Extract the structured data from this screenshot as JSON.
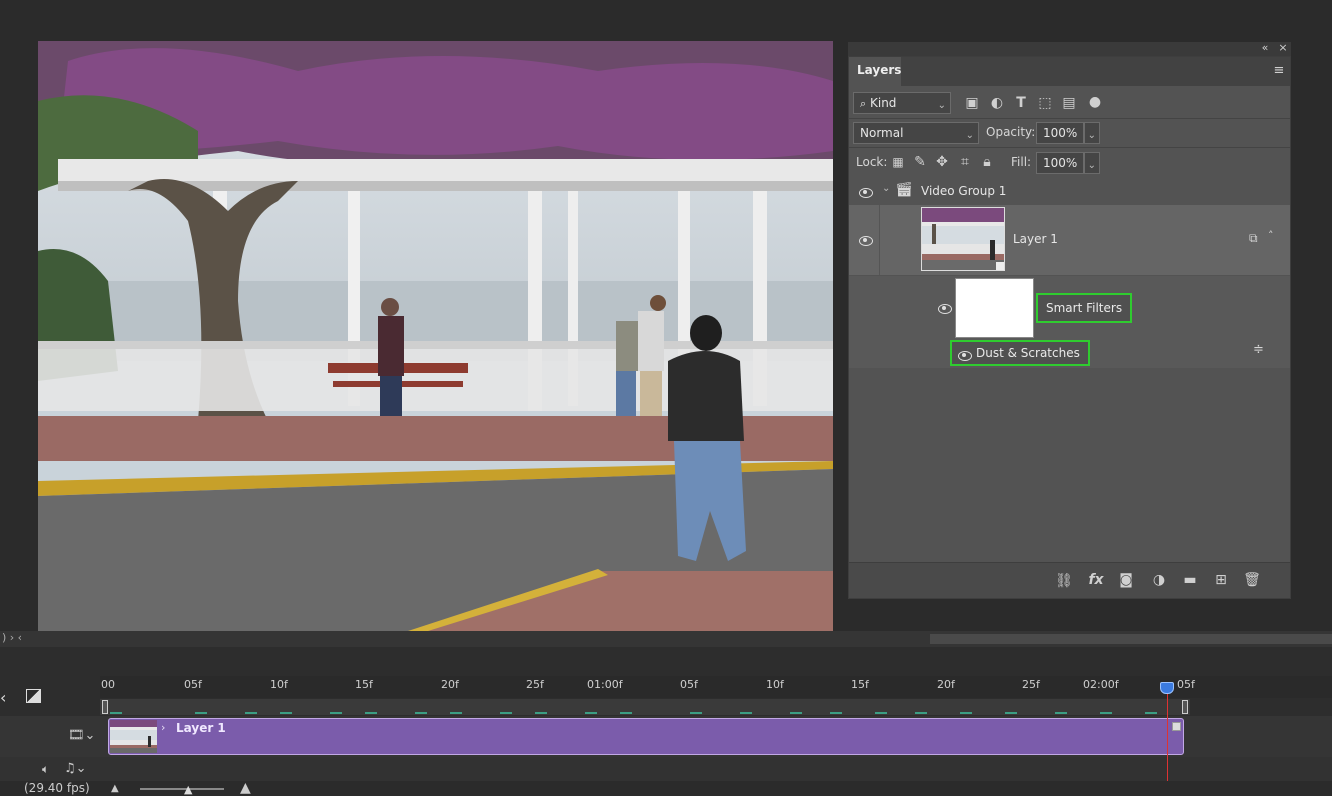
{
  "layers_panel": {
    "tab_label": "Layers",
    "filter_kind": "Kind",
    "blend_mode": "Normal",
    "opacity_label": "Opacity:",
    "opacity_value": "100%",
    "lock_label": "Lock:",
    "fill_label": "Fill:",
    "fill_value": "100%",
    "group_name": "Video Group 1",
    "layer_name": "Layer 1",
    "smart_filters_label": "Smart Filters",
    "filter_name": "Dust & Scratches"
  },
  "timeline": {
    "ticks": [
      "00",
      "05f",
      "10f",
      "15f",
      "20f",
      "25f",
      "01:00f",
      "05f",
      "10f",
      "15f",
      "20f",
      "25f",
      "02:00f",
      "05f"
    ],
    "clip_name": "Layer 1",
    "fps": "(29.40 fps)"
  },
  "colors": {
    "clip": "#7b5cab",
    "highlight": "#2fcc2f",
    "playhead": "#dd3333",
    "panel": "#535353"
  }
}
